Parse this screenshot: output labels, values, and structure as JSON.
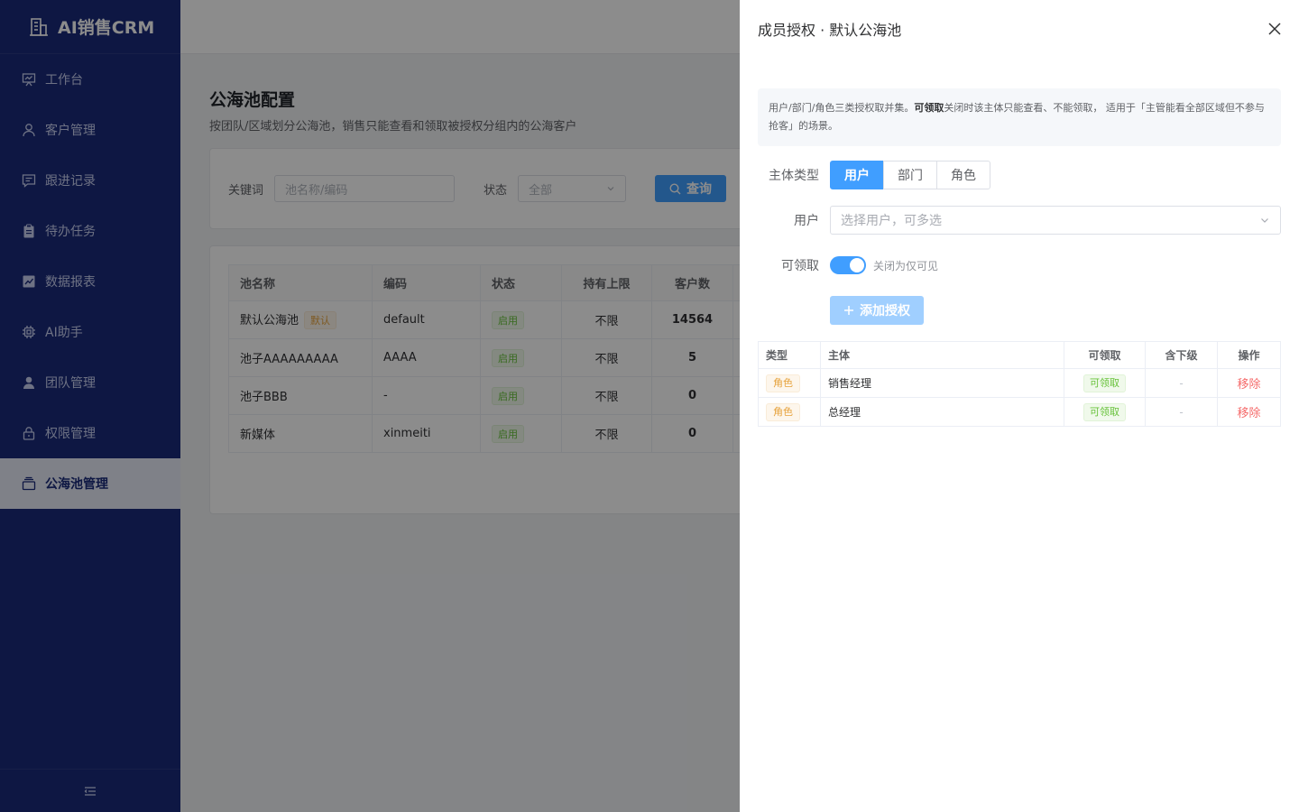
{
  "app": {
    "title": "AI销售CRM"
  },
  "sidebar": {
    "items": [
      {
        "label": "工作台",
        "icon": "presentation-board-icon"
      },
      {
        "label": "客户管理",
        "icon": "user-icon"
      },
      {
        "label": "跟进记录",
        "icon": "message-icon"
      },
      {
        "label": "待办任务",
        "icon": "clipboard-icon"
      },
      {
        "label": "数据报表",
        "icon": "chart-icon"
      },
      {
        "label": "AI助手",
        "icon": "chip-icon"
      },
      {
        "label": "团队管理",
        "icon": "team-icon"
      },
      {
        "label": "权限管理",
        "icon": "lock-icon"
      },
      {
        "label": "公海池管理",
        "icon": "box-icon"
      }
    ],
    "active": "公海池管理"
  },
  "page": {
    "title": "公海池配置",
    "subtitle": "按团队/区域划分公海池，销售只能查看和领取被授权分组内的公海客户"
  },
  "filter": {
    "keyword_label": "关键词",
    "keyword_placeholder": "池名称/编码",
    "status_label": "状态",
    "status_value": "全部",
    "query_label": "查询"
  },
  "table": {
    "columns": [
      "池名称",
      "编码",
      "状态",
      "持有上限",
      "客户数"
    ],
    "rows": [
      {
        "name": "默认公海池",
        "badge": "默认",
        "code": "default",
        "status": "启用",
        "limit": "不限",
        "count": "14564"
      },
      {
        "name": "池子AAAAAAAAA",
        "badge": "",
        "code": "AAAA",
        "status": "启用",
        "limit": "不限",
        "count": "5"
      },
      {
        "name": "池子BBB",
        "badge": "",
        "code": "-",
        "status": "启用",
        "limit": "不限",
        "count": "0"
      },
      {
        "name": "新媒体",
        "badge": "",
        "code": "xinmeiti",
        "status": "启用",
        "limit": "不限",
        "count": "0"
      }
    ]
  },
  "drawer": {
    "title": "成员授权 · 默认公海池",
    "info_pre": "用户/部门/角色三类授权取并集。",
    "info_bold": "可领取",
    "info_post": "关闭时该主体只能查看、不能领取， 适用于「主管能看全部区域但不参与抢客」的场景。",
    "subject_type_label": "主体类型",
    "subject_types": [
      "用户",
      "部门",
      "角色"
    ],
    "subject_type_selected": "用户",
    "user_label": "用户",
    "user_placeholder": "选择用户，可多选",
    "claimable_label": "可领取",
    "claimable_on": true,
    "claimable_hint": "关闭为仅可见",
    "add_label": "添加授权",
    "auth_columns": [
      "类型",
      "主体",
      "可领取",
      "含下级",
      "操作"
    ],
    "auth_rows": [
      {
        "type": "角色",
        "subject": "销售经理",
        "claimable": "可领取",
        "sub": "-",
        "action": "移除"
      },
      {
        "type": "角色",
        "subject": "总经理",
        "claimable": "可领取",
        "sub": "-",
        "action": "移除"
      }
    ]
  },
  "colors": {
    "sidebar": "#1a2a7a",
    "primary": "#409eff",
    "danger": "#f56c6c",
    "success": "#67c23a",
    "warning": "#e6a23c"
  }
}
